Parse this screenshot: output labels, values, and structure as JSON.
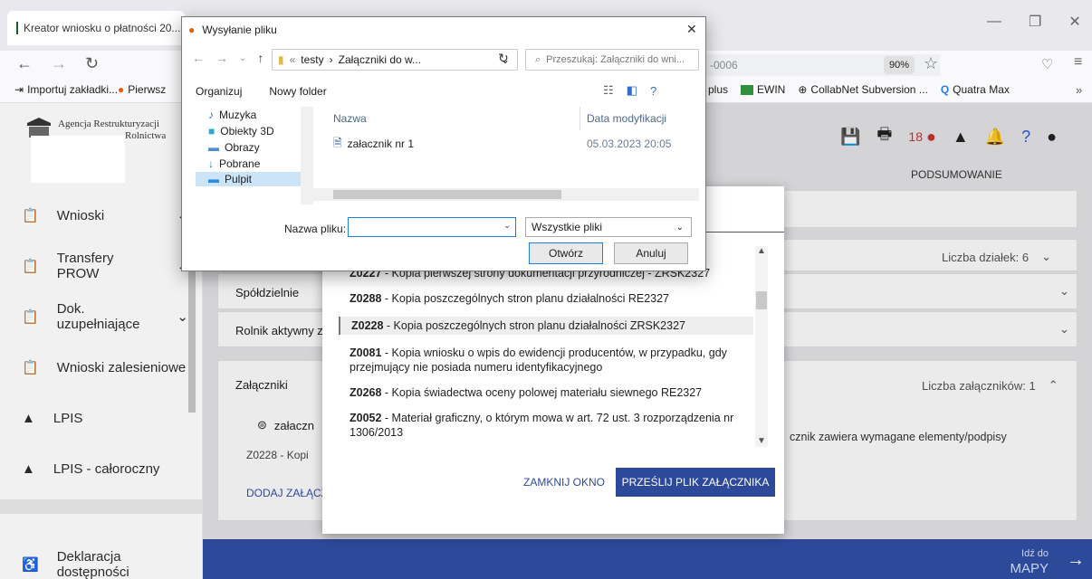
{
  "browser": {
    "tab_title": "Kreator wniosku o płatności 20...",
    "url_fragment": "-0006",
    "zoom": "90%",
    "bookmarks": [
      {
        "label": "Importuj zakładki..."
      },
      {
        "label": "Pierwsz"
      },
      {
        "label": "plus"
      },
      {
        "label": "EWIN"
      },
      {
        "label": "CollabNet Subversion ..."
      },
      {
        "label": "Quatra Max"
      }
    ]
  },
  "app": {
    "org_line1": "Agencja Restrukturyzacji",
    "org_line2": "Rolnictwa",
    "toolbar_count": "18",
    "tab_summary": "PODSUMOWANIE"
  },
  "sidebar": {
    "items": [
      {
        "label": "Wnioski"
      },
      {
        "label": "Transfery PROW"
      },
      {
        "label": "Dok. uzupełniające"
      },
      {
        "label": "Wnioski zalesieniowe"
      },
      {
        "label": "LPIS"
      },
      {
        "label": "LPIS - całoroczny"
      },
      {
        "label": "Deklaracja dostępności"
      }
    ]
  },
  "main": {
    "plots_label": "Liczba działek: 6",
    "coop_label": "Spółdzielnie",
    "farmer_label": "Rolnik aktywny z",
    "attachments_label": "Załączniki",
    "attachments_count": "Liczba załączników: 1",
    "attachment_file": "załaczn",
    "attachment_code": "Z0228 - Kopi",
    "attachment_note": "cznik zawiera wymagane elementy/podpisy",
    "add_attachment": "DODAJ ZAŁĄCZ",
    "go_to_small": "Idź do",
    "go_to_big": "MAPY"
  },
  "modal": {
    "items": [
      {
        "code": "Z0227",
        "text": " - Kopia pierwszej strony dokumentacji przyrodniczej - ZRSK2327"
      },
      {
        "code": "Z0288",
        "text": " - Kopia poszczególnych stron planu działalności RE2327"
      },
      {
        "code": "Z0228",
        "text": " - Kopia poszczególnych stron planu działalności ZRSK2327"
      },
      {
        "code": "Z0081",
        "text": " - Kopia wniosku o wpis do ewidencji producentów, w przypadku, gdy przejmujący nie posiada numeru identyfikacyjnego"
      },
      {
        "code": "Z0268",
        "text": " - Kopia świadectwa oceny polowej materiału siewnego RE2327"
      },
      {
        "code": "Z0052",
        "text": " - Materiał graficzny, o którym mowa w art. 72 ust. 3 rozporządzenia nr 1306/2013"
      }
    ],
    "close_button": "ZAMKNIJ OKNO",
    "send_button": "PRZEŚLIJ PLIK ZAŁĄCZNIKA"
  },
  "file_dialog": {
    "title": "Wysyłanie pliku",
    "path_prefix": "«",
    "path_folder": "testy",
    "path_sep": "›",
    "path_current": "Załączniki do w...",
    "search_placeholder": "Przeszukaj: Załączniki do wni...",
    "organize": "Organizuj",
    "new_folder": "Nowy folder",
    "tree": [
      {
        "label": "Muzyka",
        "color": "#2c6fd6"
      },
      {
        "label": "Obiekty 3D",
        "color": "#2aa8d6"
      },
      {
        "label": "Obrazy",
        "color": "#4d8fd1"
      },
      {
        "label": "Pobrane",
        "color": "#2c6fd6"
      },
      {
        "label": "Pulpit",
        "color": "#2a8fe0"
      }
    ],
    "col_name": "Nazwa",
    "col_date": "Data modyfikacji",
    "file_name": "załacznik nr 1",
    "file_date": "05.03.2023 20:05",
    "filename_label": "Nazwa pliku:",
    "filter": "Wszystkie pliki",
    "open": "Otwórz",
    "cancel": "Anuluj"
  }
}
